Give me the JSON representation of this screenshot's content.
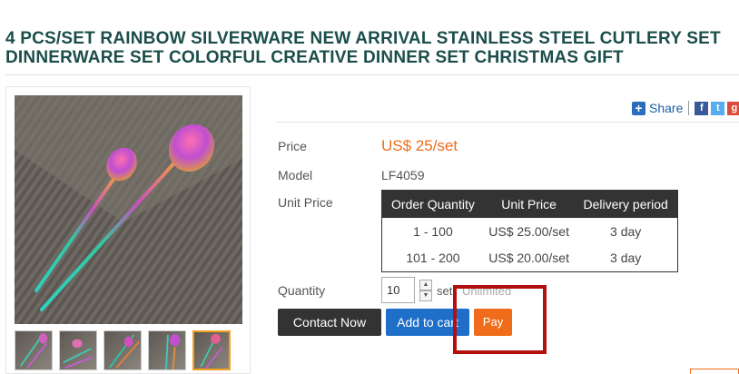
{
  "product": {
    "title": "4 PCS/SET RAINBOW SILVERWARE NEW ARRIVAL STAINLESS STEEL CUTLERY SET DINNERWARE SET COLORFUL CREATIVE DINNER SET CHRISTMAS GIFT"
  },
  "share": {
    "label": "Share",
    "networks": [
      "facebook-icon",
      "twitter-icon",
      "google-plus-icon"
    ]
  },
  "details": {
    "price_label": "Price",
    "price_value": "US$ 25/set",
    "model_label": "Model",
    "model_value": "LF4059",
    "unit_price_label": "Unit Price",
    "quantity_label": "Quantity"
  },
  "price_table": {
    "headers": [
      "Order Quantity",
      "Unit Price",
      "Delivery period"
    ],
    "rows": [
      [
        "1 - 100",
        "US$ 25.00/set",
        "3 day"
      ],
      [
        "101 - 200",
        "US$ 20.00/set",
        "3 day"
      ]
    ]
  },
  "quantity": {
    "value": "10",
    "unit": "set",
    "stock": "Unlimited"
  },
  "actions": {
    "contact_label": "Contact Now",
    "cart_label": "Add to cart",
    "pay_label": "Pay"
  },
  "colors": {
    "accent": "#f06c1a",
    "primary_blue": "#1f6fc9",
    "title_color": "#1b4e4a",
    "highlight": "#b31010"
  }
}
